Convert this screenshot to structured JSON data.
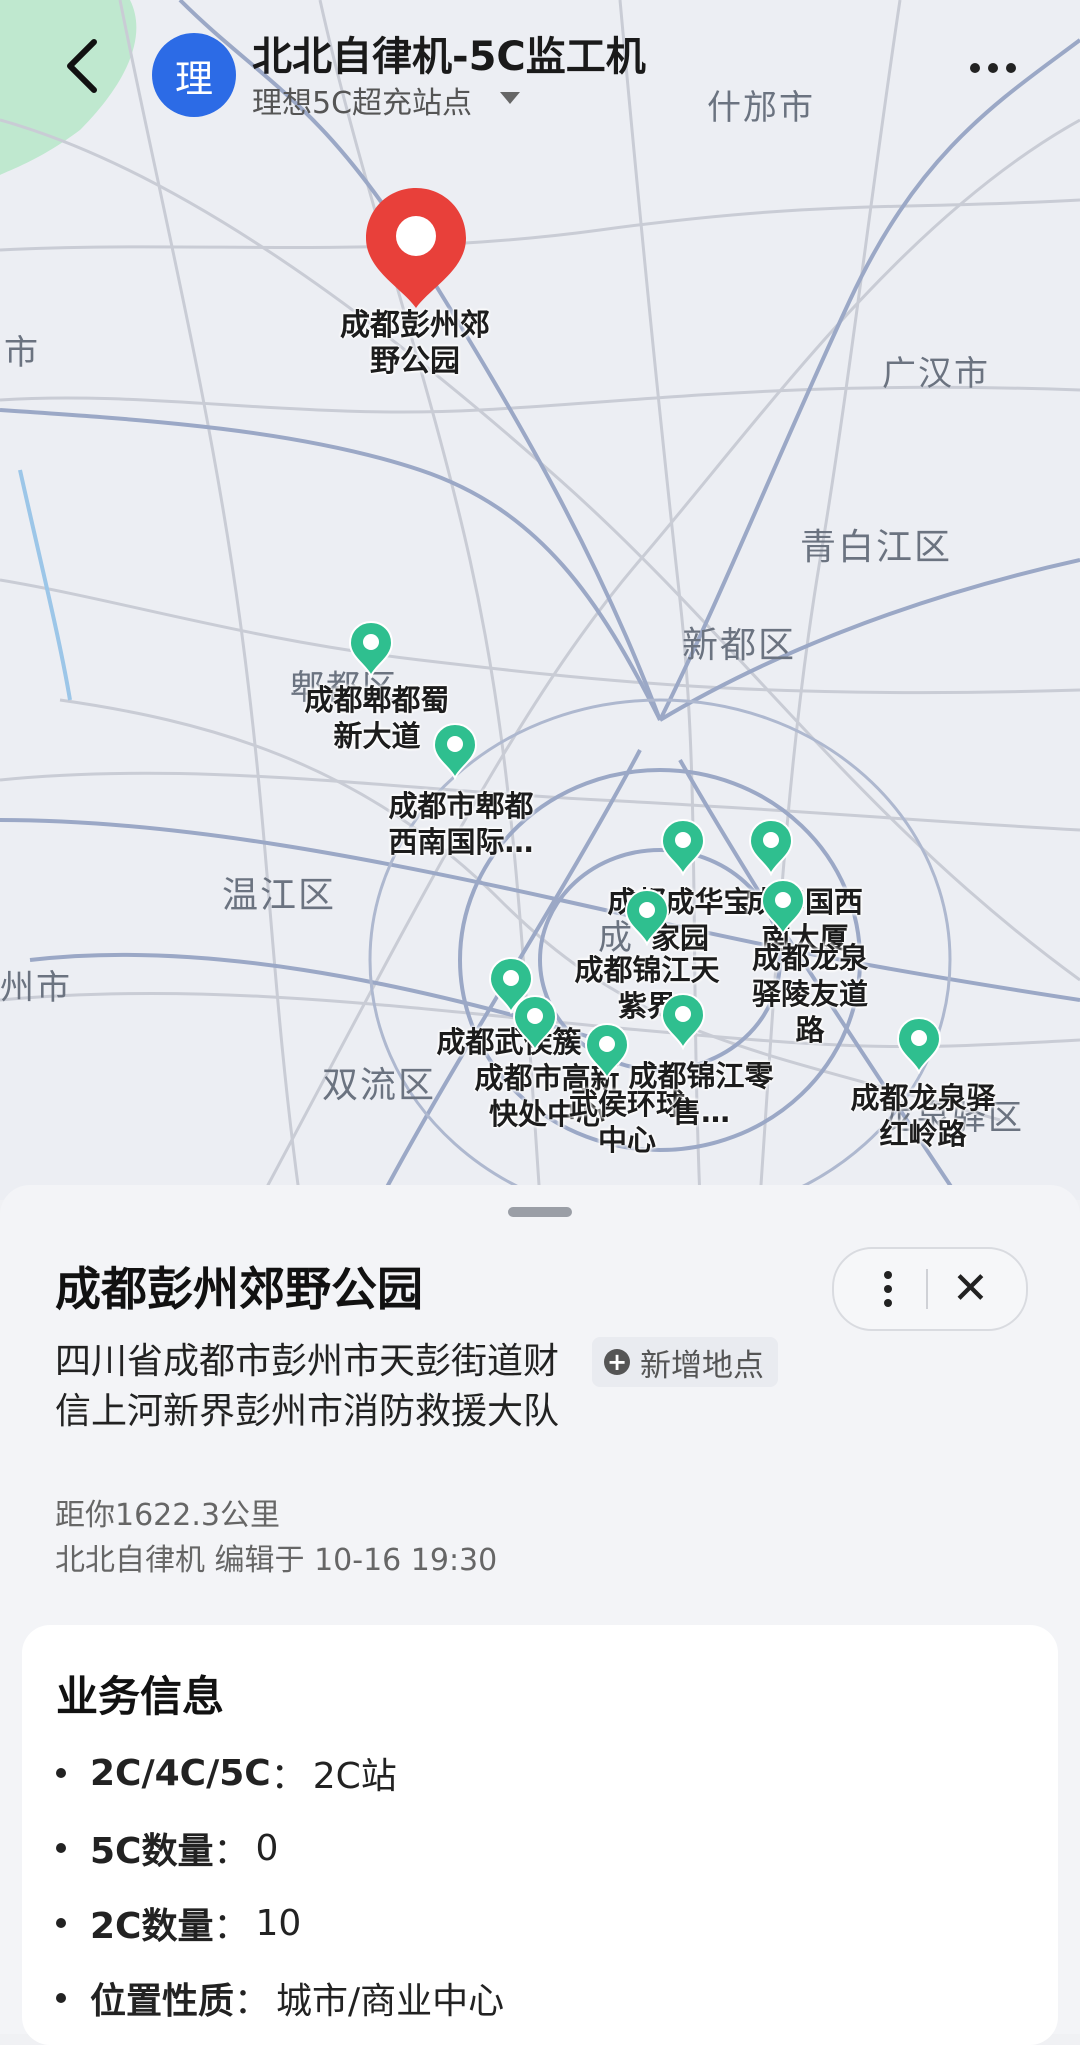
{
  "header": {
    "title": "北北自律机-5C监工机",
    "avatar_text": "理",
    "subtitle": "理想5C超充站点"
  },
  "map": {
    "places": [
      {
        "label": "什邡市"
      },
      {
        "label": "市"
      },
      {
        "label": "广汉市"
      },
      {
        "label": "青白江区"
      },
      {
        "label": "新都区"
      },
      {
        "label": "郫都区"
      },
      {
        "label": "温江区"
      },
      {
        "label": "州市"
      },
      {
        "label": "双流区"
      },
      {
        "label": "成"
      },
      {
        "label": "龙泉驿区"
      }
    ],
    "selected_pin": {
      "label": "成都彭州郊野公园",
      "color": "#e8403a"
    },
    "pins": [
      {
        "label": "成都郫都蜀新大道",
        "color": "#2fbf8f"
      },
      {
        "label": "成都市郫都西南国际…",
        "color": "#2fbf8f"
      },
      {
        "label": "成都成华宝家园",
        "color": "#2fbf8f"
      },
      {
        "label": "成华国西南大厦",
        "color": "#2fbf8f"
      },
      {
        "label": "成都龙泉驿陵友道路",
        "color": "#2fbf8f"
      },
      {
        "label": "成都锦江天紫界",
        "color": "#2fbf8f"
      },
      {
        "label": "成都武侯簇",
        "color": "#2fbf8f"
      },
      {
        "label": "成都市高新快处中心",
        "color": "#2fbf8f"
      },
      {
        "label": "武侯环球中心",
        "color": "#2fbf8f"
      },
      {
        "label": "成都锦江零售…",
        "color": "#2fbf8f"
      },
      {
        "label": "成都龙泉驿红岭路",
        "color": "#2fbf8f"
      }
    ]
  },
  "poi": {
    "name": "成都彭州郊野公园",
    "address": "四川省成都市彭州市天彭街道财信上河新界彭州市消防救援大队",
    "add_place_label": "新增地点",
    "distance": "距你1622.3公里",
    "edited": "北北自律机 编辑于 10-16 19:30"
  },
  "business": {
    "title": "业务信息",
    "rows": [
      {
        "key": "2C/4C/5C",
        "value": "2C站"
      },
      {
        "key": "5C数量",
        "value": "0"
      },
      {
        "key": "2C数量",
        "value": "10"
      },
      {
        "key": "位置性质",
        "value": "城市/商业中心"
      }
    ]
  }
}
